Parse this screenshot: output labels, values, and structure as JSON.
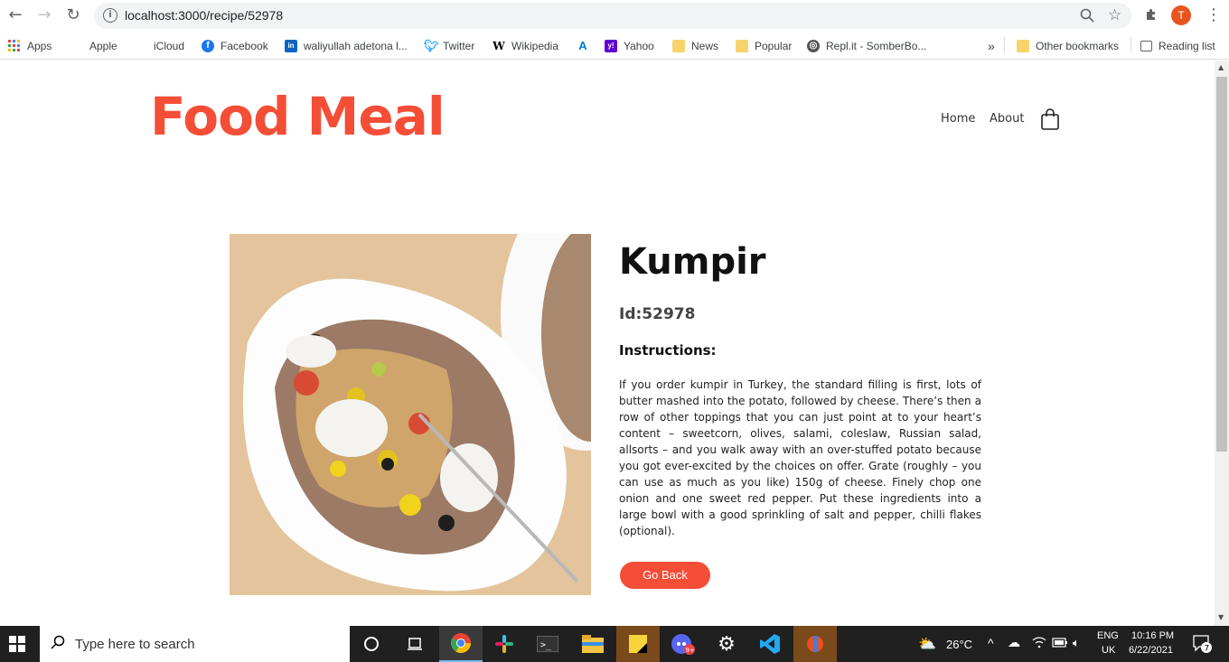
{
  "browser": {
    "url": "localhost:3000/recipe/52978",
    "profile_initial": "T",
    "bookmarks": [
      {
        "label": "Apps",
        "icon": "apps-grid-icon"
      },
      {
        "label": "Apple",
        "icon": "apple-icon"
      },
      {
        "label": "iCloud",
        "icon": "apple-icon"
      },
      {
        "label": "Facebook",
        "icon": "facebook-icon"
      },
      {
        "label": "waliyullah adetona l...",
        "icon": "linkedin-icon"
      },
      {
        "label": "Twitter",
        "icon": "twitter-icon"
      },
      {
        "label": "Wikipedia",
        "icon": "wikipedia-icon"
      },
      {
        "label": "",
        "icon": "azure-icon"
      },
      {
        "label": "Yahoo",
        "icon": "yahoo-icon"
      },
      {
        "label": "News",
        "icon": "folder-icon"
      },
      {
        "label": "Popular",
        "icon": "folder-icon"
      },
      {
        "label": "Repl.it - SomberBo...",
        "icon": "replit-icon"
      }
    ],
    "overflow": "»",
    "other_bookmarks": "Other bookmarks",
    "reading_list": "Reading list"
  },
  "header": {
    "logo": "Food Meal",
    "nav": [
      "Home",
      "About"
    ]
  },
  "recipe": {
    "title": "Kumpir",
    "id_label": "Id:52978",
    "instructions_heading": "Instructions:",
    "instructions": "If you order kumpir in Turkey, the standard filling is first, lots of butter mashed into the potato, followed by cheese. There’s then a row of other toppings that you can just point at to your heart’s content – sweetcorn, olives, salami, coleslaw, Russian salad, allsorts – and you walk away with an over-stuffed potato because you got ever-excited by the choices on offer. Grate (roughly – you can use as much as you like) 150g of cheese. Finely chop one onion and one sweet red pepper. Put these ingredients into a large bowl with a good sprinkling of salt and pepper, chilli flakes (optional).",
    "back_button": "Go Back"
  },
  "taskbar": {
    "search_placeholder": "Type here to search",
    "weather": "26°C",
    "lang_top": "ENG",
    "lang_bottom": "UK",
    "time": "10:16 PM",
    "date": "6/22/2021",
    "notification_count": "7",
    "discord_badge": "9+"
  },
  "colors": {
    "accent": "#f54e37",
    "taskbar": "#202020"
  }
}
